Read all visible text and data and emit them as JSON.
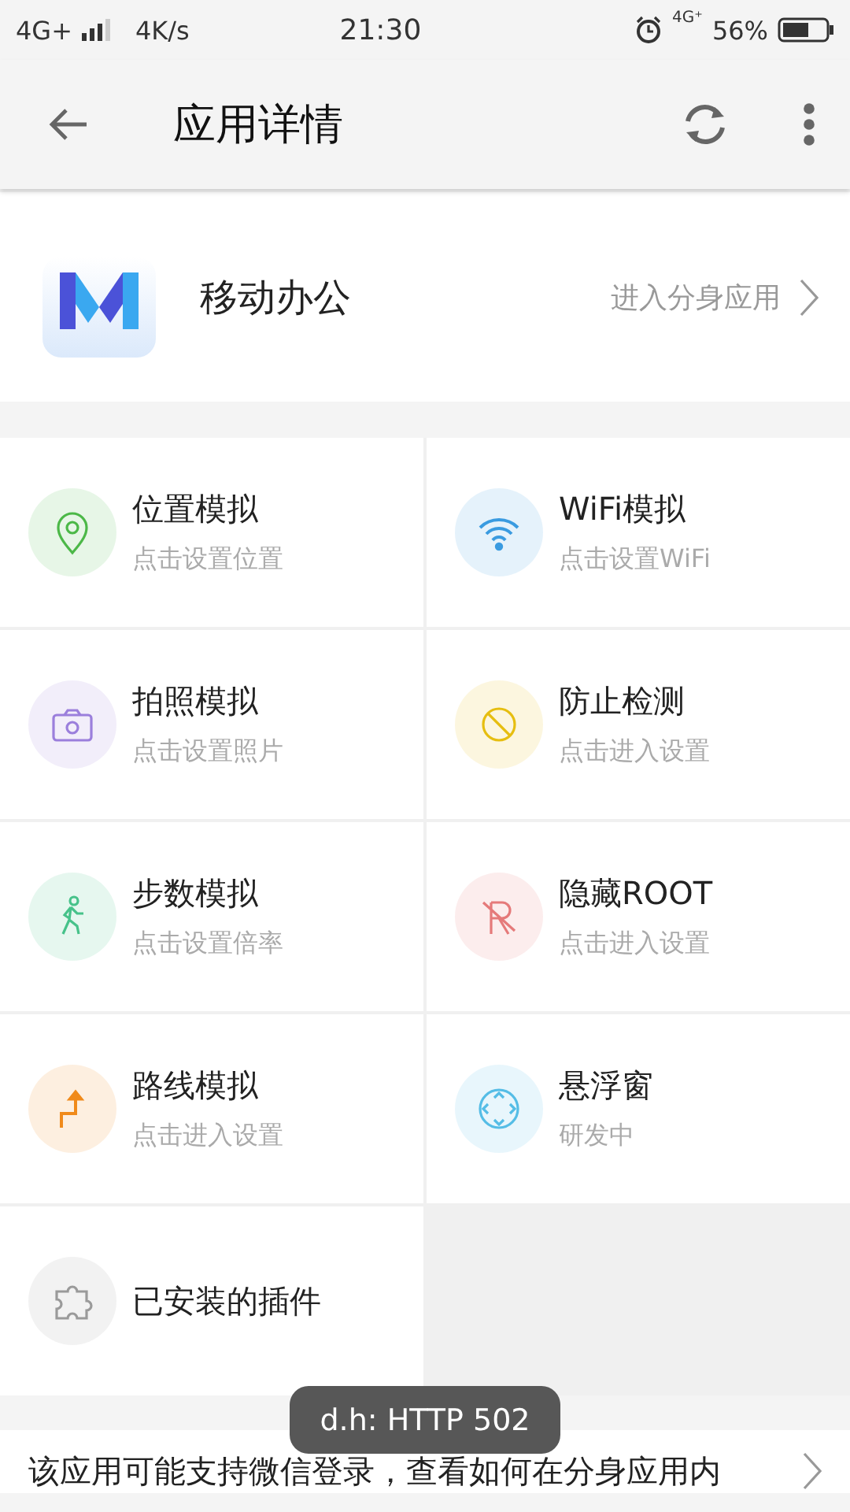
{
  "status_bar": {
    "network": "4G+",
    "speed": "4K/s",
    "time": "21:30",
    "network_small": "4G⁺",
    "battery": "56%"
  },
  "header": {
    "title": "应用详情"
  },
  "app": {
    "name": "移动办公",
    "action": "进入分身应用"
  },
  "features": [
    {
      "kind": "pin",
      "title": "位置模拟",
      "subtitle": "点击设置位置",
      "color": "#4cb848"
    },
    {
      "kind": "wifi",
      "title": "WiFi模拟",
      "subtitle": "点击设置WiFi",
      "color": "#3a9be0"
    },
    {
      "kind": "camera",
      "title": "拍照模拟",
      "subtitle": "点击设置照片",
      "color": "#9b7fdc"
    },
    {
      "kind": "block",
      "title": "防止检测",
      "subtitle": "点击进入设置",
      "color": "#e6be10"
    },
    {
      "kind": "walker",
      "title": "步数模拟",
      "subtitle": "点击设置倍率",
      "color": "#47c28a"
    },
    {
      "kind": "root",
      "title": "隐藏ROOT",
      "subtitle": "点击进入设置",
      "color": "#e57a7a"
    },
    {
      "kind": "route",
      "title": "路线模拟",
      "subtitle": "点击进入设置",
      "color": "#f08a1a"
    },
    {
      "kind": "float",
      "title": "悬浮窗",
      "subtitle": "研发中",
      "color": "#55bde6"
    },
    {
      "kind": "puzzle",
      "title": "已安装的插件",
      "color": "#9a9a9a"
    }
  ],
  "tip": {
    "text": "该应用可能支持微信登录，查看如何在分身应用内"
  },
  "toast": {
    "text": "d.h: HTTP 502"
  }
}
